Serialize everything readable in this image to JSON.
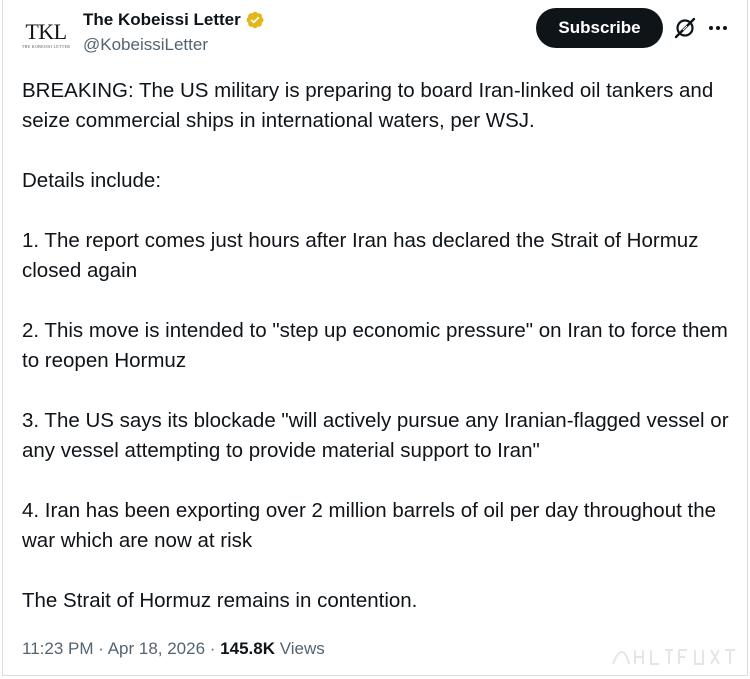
{
  "author": {
    "avatar_monogram": "TKL",
    "avatar_subtitle": "THE KOBEISSI LETTER",
    "display_name": "The Kobeissi Letter",
    "handle": "@KobeissiLetter",
    "verified_icon": "gold-verified-badge-icon",
    "verified_color": "#e2b719"
  },
  "actions": {
    "subscribe_label": "Subscribe",
    "grok_icon": "grok-icon",
    "more_icon": "more-options-icon"
  },
  "post": {
    "paragraphs": [
      "BREAKING: The US military is preparing to board Iran-linked oil tankers and seize commercial ships in international waters, per WSJ.",
      "Details include:",
      "1. The report comes just hours after Iran has declared the Strait of Hormuz closed again",
      "2. This move is intended to \"step up economic pressure\" on Iran to force them to reopen Hormuz",
      "3. The US says its blockade \"will actively pursue any Iranian-flagged vessel or any vessel attempting to provide material support to Iran\"",
      "4. Iran has been exporting over 2 million barrels of oil per day throughout the war which are now at risk",
      "The Strait of Hormuz remains in contention."
    ]
  },
  "meta": {
    "time": "11:23 PM",
    "separator": " · ",
    "date": "Apr 18, 2026",
    "views_count": "145.8K",
    "views_label": " Views"
  },
  "colors": {
    "text_primary": "#0f1419",
    "text_secondary": "#536471",
    "button_bg": "#0f1419",
    "border": "#d9dde1"
  }
}
